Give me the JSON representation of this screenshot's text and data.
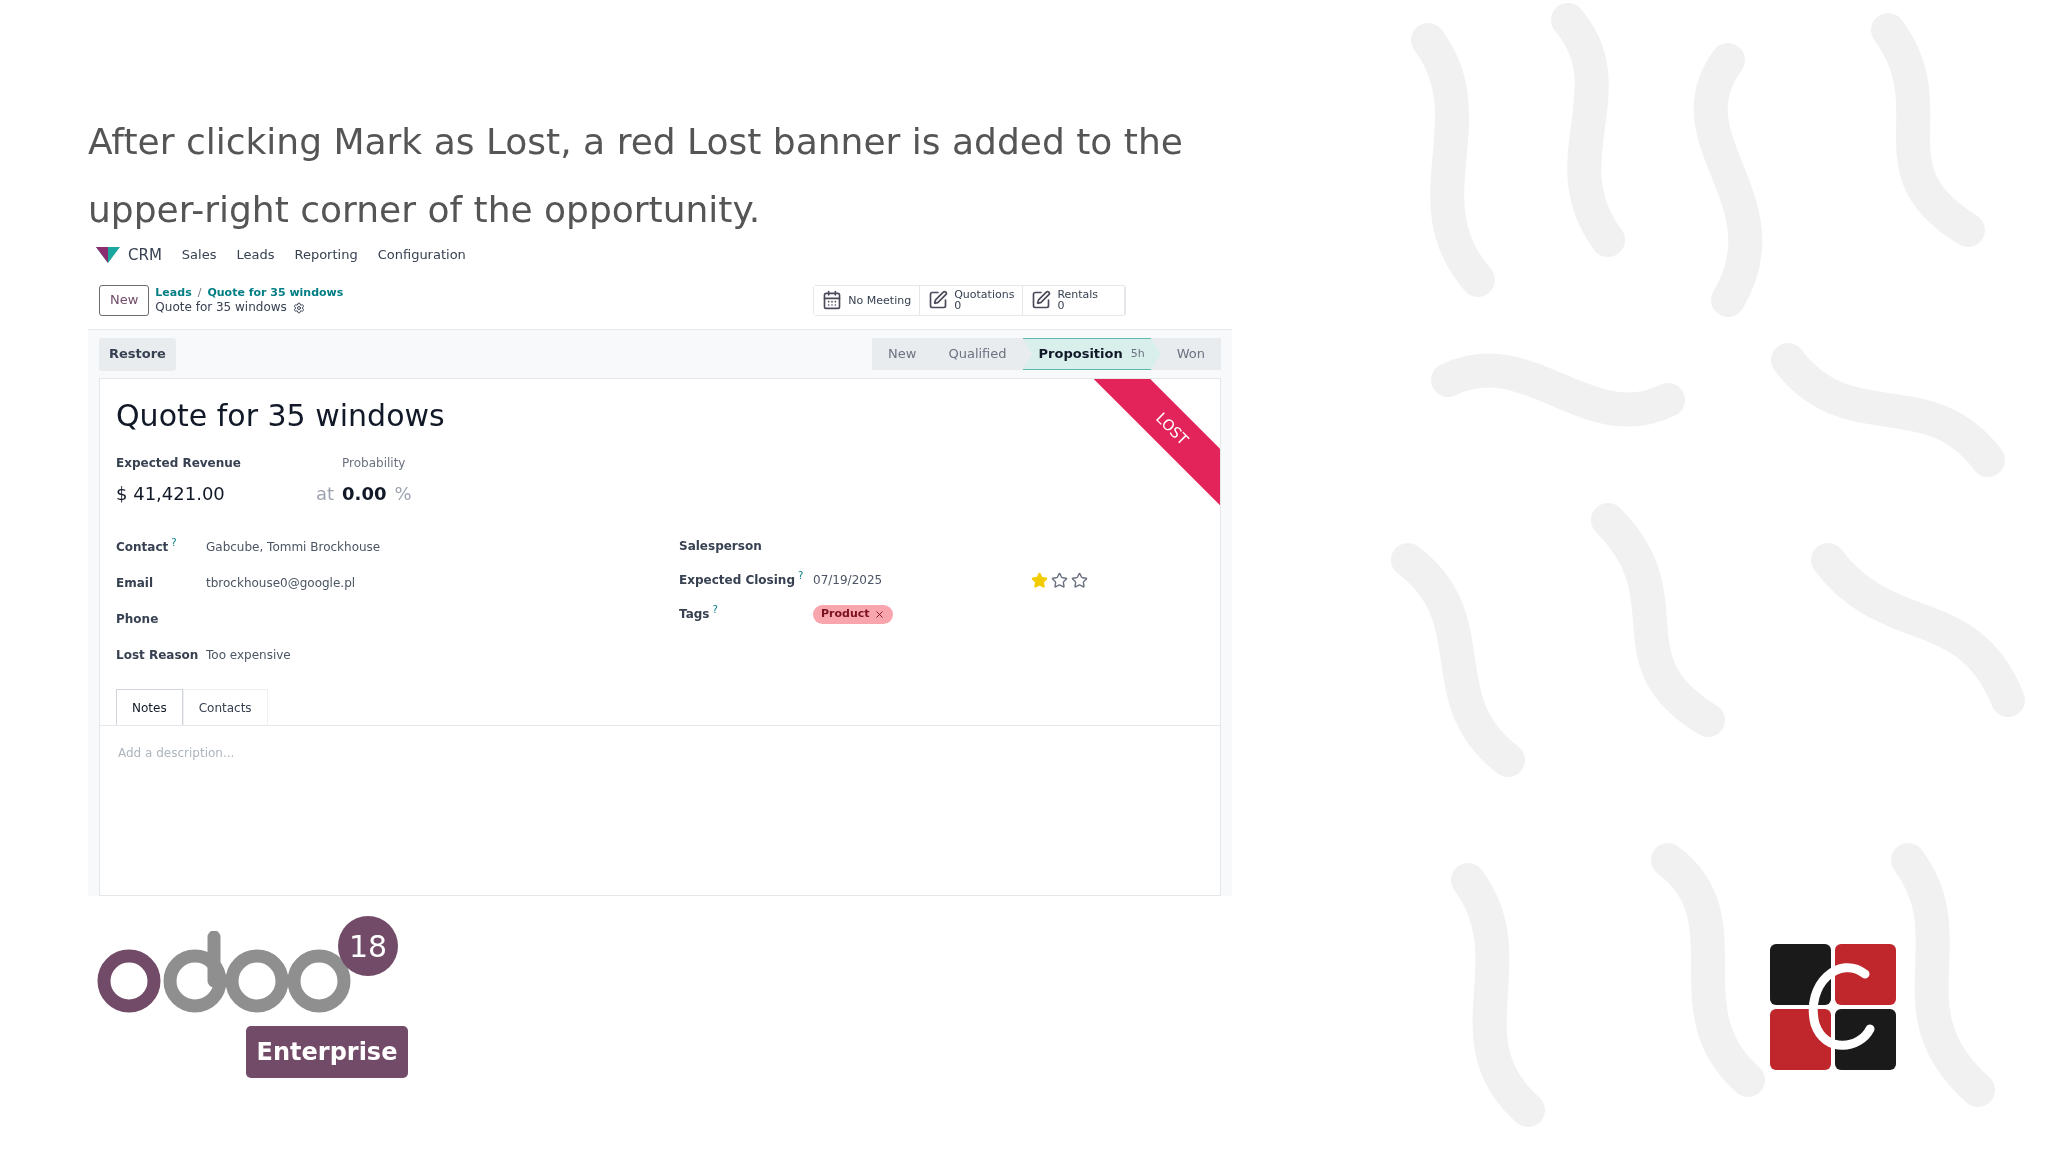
{
  "caption": "After clicking Mark as Lost, a red Lost banner is added to the upper-right corner of the opportunity.",
  "app": {
    "nav": {
      "app_name": "CRM",
      "menu": [
        "Sales",
        "Leads",
        "Reporting",
        "Configuration"
      ]
    },
    "new_button": "New",
    "breadcrumb": {
      "links": [
        "Leads",
        "Quote for 35 windows"
      ],
      "separator": "/",
      "title": "Quote for 35 windows"
    },
    "smart_buttons": [
      {
        "kind": "calendar",
        "label": "No Meeting"
      },
      {
        "kind": "edit",
        "label": "Quotations",
        "count": "0"
      },
      {
        "kind": "edit",
        "label": "Rentals",
        "count": "0"
      }
    ],
    "restore_button": "Restore",
    "stages": [
      {
        "label": "New",
        "selected": false
      },
      {
        "label": "Qualified",
        "selected": false
      },
      {
        "label": "Proposition",
        "selected": true,
        "duration": "5h"
      },
      {
        "label": "Won",
        "selected": false
      }
    ],
    "record": {
      "title": "Quote for 35 windows",
      "ribbon": "LOST",
      "revenue_label": "Expected Revenue",
      "revenue": "$ 41,421.00",
      "probability_label": "Probability",
      "probability_prefix": "at",
      "probability": "0.00",
      "probability_suffix": "%",
      "left_fields": [
        {
          "label": "Contact",
          "help": "?",
          "value": "Gabcube, Tommi Brockhouse"
        },
        {
          "label": "Email",
          "value": "tbrockhouse0@google.pl"
        },
        {
          "label": "Phone"
        },
        {
          "label": "Lost Reason",
          "value": "Too expensive"
        }
      ],
      "right_fields": [
        {
          "kind": "text",
          "label": "Salesperson"
        },
        {
          "kind": "date",
          "label": "Expected Closing",
          "help": "?",
          "value": "07/19/2025",
          "stars": 1
        },
        {
          "kind": "tags",
          "label": "Tags",
          "help": "?",
          "tags": [
            {
              "label": "Product",
              "color": "#f8a5ad"
            }
          ]
        }
      ]
    },
    "tabs": [
      {
        "label": "Notes",
        "selected": true
      },
      {
        "label": "Contacts",
        "selected": false
      }
    ],
    "notes_placeholder": "Add a description..."
  },
  "branding": {
    "version": "18",
    "edition": "Enterprise"
  }
}
